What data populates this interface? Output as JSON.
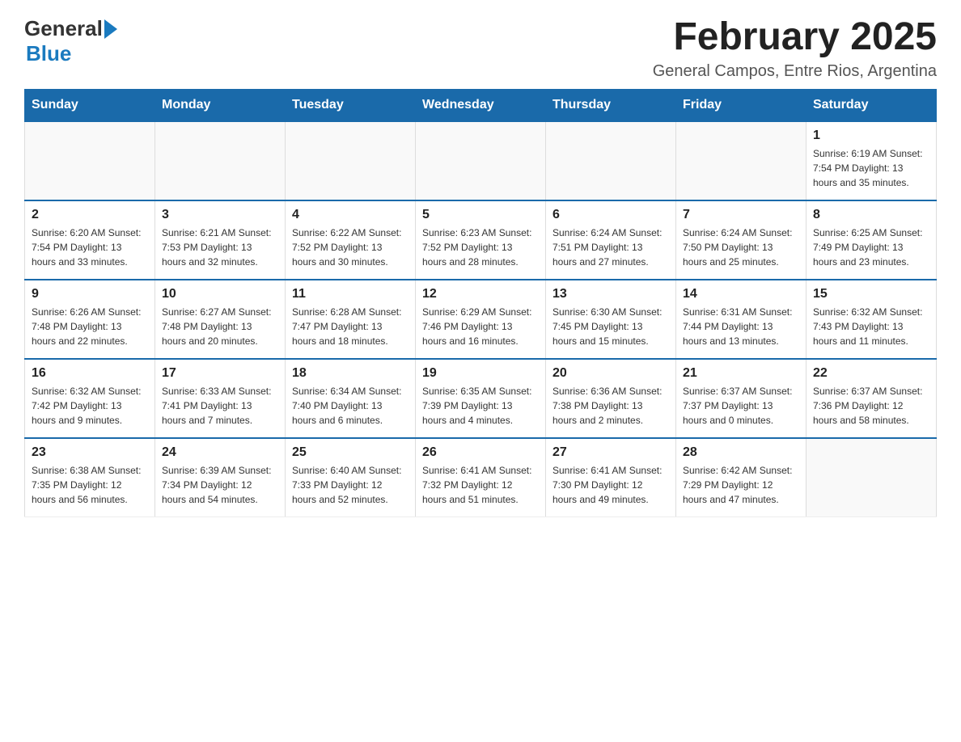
{
  "header": {
    "logo_line1": "General",
    "logo_line2": "Blue",
    "title": "February 2025",
    "subtitle": "General Campos, Entre Rios, Argentina"
  },
  "weekdays": [
    "Sunday",
    "Monday",
    "Tuesday",
    "Wednesday",
    "Thursday",
    "Friday",
    "Saturday"
  ],
  "weeks": [
    [
      {
        "day": "",
        "info": ""
      },
      {
        "day": "",
        "info": ""
      },
      {
        "day": "",
        "info": ""
      },
      {
        "day": "",
        "info": ""
      },
      {
        "day": "",
        "info": ""
      },
      {
        "day": "",
        "info": ""
      },
      {
        "day": "1",
        "info": "Sunrise: 6:19 AM\nSunset: 7:54 PM\nDaylight: 13 hours and 35 minutes."
      }
    ],
    [
      {
        "day": "2",
        "info": "Sunrise: 6:20 AM\nSunset: 7:54 PM\nDaylight: 13 hours and 33 minutes."
      },
      {
        "day": "3",
        "info": "Sunrise: 6:21 AM\nSunset: 7:53 PM\nDaylight: 13 hours and 32 minutes."
      },
      {
        "day": "4",
        "info": "Sunrise: 6:22 AM\nSunset: 7:52 PM\nDaylight: 13 hours and 30 minutes."
      },
      {
        "day": "5",
        "info": "Sunrise: 6:23 AM\nSunset: 7:52 PM\nDaylight: 13 hours and 28 minutes."
      },
      {
        "day": "6",
        "info": "Sunrise: 6:24 AM\nSunset: 7:51 PM\nDaylight: 13 hours and 27 minutes."
      },
      {
        "day": "7",
        "info": "Sunrise: 6:24 AM\nSunset: 7:50 PM\nDaylight: 13 hours and 25 minutes."
      },
      {
        "day": "8",
        "info": "Sunrise: 6:25 AM\nSunset: 7:49 PM\nDaylight: 13 hours and 23 minutes."
      }
    ],
    [
      {
        "day": "9",
        "info": "Sunrise: 6:26 AM\nSunset: 7:48 PM\nDaylight: 13 hours and 22 minutes."
      },
      {
        "day": "10",
        "info": "Sunrise: 6:27 AM\nSunset: 7:48 PM\nDaylight: 13 hours and 20 minutes."
      },
      {
        "day": "11",
        "info": "Sunrise: 6:28 AM\nSunset: 7:47 PM\nDaylight: 13 hours and 18 minutes."
      },
      {
        "day": "12",
        "info": "Sunrise: 6:29 AM\nSunset: 7:46 PM\nDaylight: 13 hours and 16 minutes."
      },
      {
        "day": "13",
        "info": "Sunrise: 6:30 AM\nSunset: 7:45 PM\nDaylight: 13 hours and 15 minutes."
      },
      {
        "day": "14",
        "info": "Sunrise: 6:31 AM\nSunset: 7:44 PM\nDaylight: 13 hours and 13 minutes."
      },
      {
        "day": "15",
        "info": "Sunrise: 6:32 AM\nSunset: 7:43 PM\nDaylight: 13 hours and 11 minutes."
      }
    ],
    [
      {
        "day": "16",
        "info": "Sunrise: 6:32 AM\nSunset: 7:42 PM\nDaylight: 13 hours and 9 minutes."
      },
      {
        "day": "17",
        "info": "Sunrise: 6:33 AM\nSunset: 7:41 PM\nDaylight: 13 hours and 7 minutes."
      },
      {
        "day": "18",
        "info": "Sunrise: 6:34 AM\nSunset: 7:40 PM\nDaylight: 13 hours and 6 minutes."
      },
      {
        "day": "19",
        "info": "Sunrise: 6:35 AM\nSunset: 7:39 PM\nDaylight: 13 hours and 4 minutes."
      },
      {
        "day": "20",
        "info": "Sunrise: 6:36 AM\nSunset: 7:38 PM\nDaylight: 13 hours and 2 minutes."
      },
      {
        "day": "21",
        "info": "Sunrise: 6:37 AM\nSunset: 7:37 PM\nDaylight: 13 hours and 0 minutes."
      },
      {
        "day": "22",
        "info": "Sunrise: 6:37 AM\nSunset: 7:36 PM\nDaylight: 12 hours and 58 minutes."
      }
    ],
    [
      {
        "day": "23",
        "info": "Sunrise: 6:38 AM\nSunset: 7:35 PM\nDaylight: 12 hours and 56 minutes."
      },
      {
        "day": "24",
        "info": "Sunrise: 6:39 AM\nSunset: 7:34 PM\nDaylight: 12 hours and 54 minutes."
      },
      {
        "day": "25",
        "info": "Sunrise: 6:40 AM\nSunset: 7:33 PM\nDaylight: 12 hours and 52 minutes."
      },
      {
        "day": "26",
        "info": "Sunrise: 6:41 AM\nSunset: 7:32 PM\nDaylight: 12 hours and 51 minutes."
      },
      {
        "day": "27",
        "info": "Sunrise: 6:41 AM\nSunset: 7:30 PM\nDaylight: 12 hours and 49 minutes."
      },
      {
        "day": "28",
        "info": "Sunrise: 6:42 AM\nSunset: 7:29 PM\nDaylight: 12 hours and 47 minutes."
      },
      {
        "day": "",
        "info": ""
      }
    ]
  ]
}
